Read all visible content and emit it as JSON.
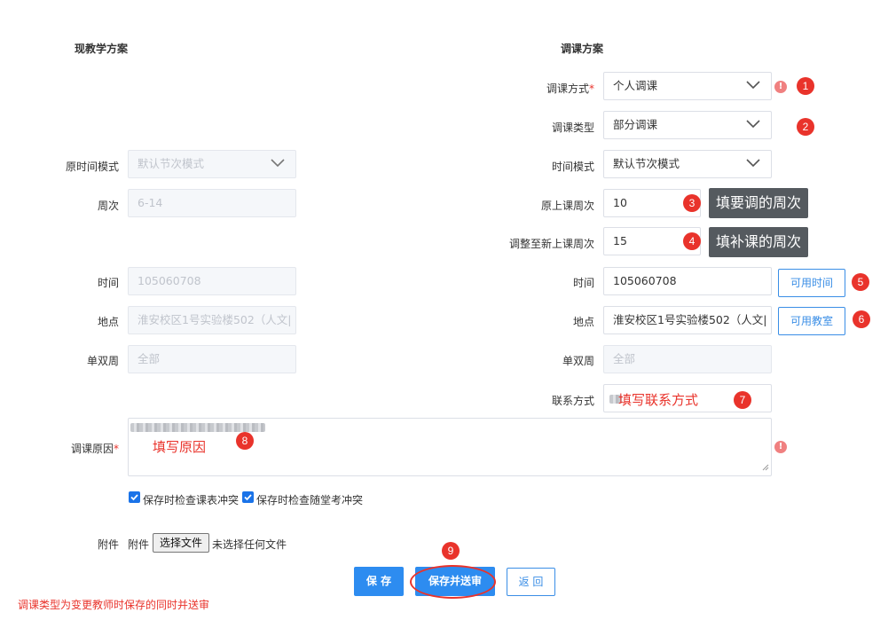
{
  "left_section": {
    "title": "现教学方案",
    "rows": [
      {
        "label": "原时间模式",
        "value": "默认节次模式"
      },
      {
        "label": "周次",
        "value": "6-14"
      },
      {
        "label": "时间",
        "value": "105060708"
      },
      {
        "label": "地点",
        "value": "淮安校区1号实验楼502（人文|"
      },
      {
        "label": "单双周",
        "value": "全部"
      }
    ]
  },
  "right_section": {
    "title": "调课方案",
    "method": {
      "label": "调课方式",
      "required_mark": "*",
      "value": "个人调课"
    },
    "type": {
      "label": "调课类型",
      "value": "部分调课"
    },
    "time_mode": {
      "label": "时间模式",
      "value": "默认节次模式"
    },
    "orig_week": {
      "label": "原上课周次",
      "value": "10"
    },
    "new_week": {
      "label": "调整至新上课周次",
      "value": "15"
    },
    "time": {
      "label": "时间",
      "value": "105060708",
      "button": "可用时间"
    },
    "location": {
      "label": "地点",
      "value": "淮安校区1号实验楼502（人文|",
      "button": "可用教室"
    },
    "odd_even": {
      "label": "单双周",
      "value": "全部"
    },
    "contact": {
      "label": "联系方式"
    }
  },
  "reason": {
    "label": "调课原因",
    "required_mark": "*"
  },
  "checkboxes": [
    {
      "label": "保存时检查课表冲突",
      "checked": true
    },
    {
      "label": "保存时检查随堂考冲突",
      "checked": true
    }
  ],
  "attachment": {
    "label": "附件",
    "inner_label": "附件",
    "button": "选择文件",
    "status": "未选择任何文件"
  },
  "buttons": {
    "save": "保 存",
    "save_submit": "保存并送审",
    "back": "返 回"
  },
  "footer_note": "调课类型为变更教师时保存的同时并送审",
  "annotations": {
    "badges": [
      "1",
      "2",
      "3",
      "4",
      "5",
      "6",
      "7",
      "8",
      "9"
    ],
    "tip_week": "填要调的周次",
    "tip_new_week": "填补课的周次",
    "contact_hint": "填写联系方式",
    "reason_hint": "填写原因",
    "warn_symbol": "!"
  },
  "colors": {
    "accent": "#2d8cf0",
    "annotation_red": "#e9332b",
    "tooltip_bg": "#555a5f"
  }
}
